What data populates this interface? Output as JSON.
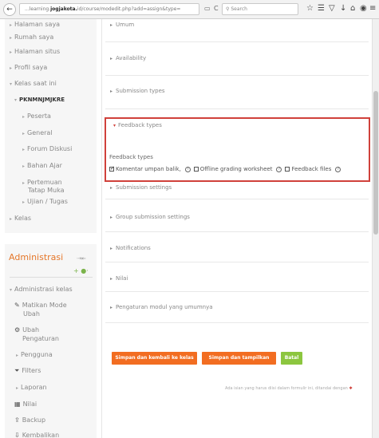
{
  "browser": {
    "url_prefix": "...learning.",
    "url_host": "jogjakota.",
    "url_path": "id/course/modedit.php?add=assign&type=",
    "reader_icon": "reader-icon",
    "refresh_icon": "refresh-icon",
    "search_placeholder": "Search"
  },
  "nav": {
    "items": [
      {
        "label": "Halaman saya",
        "caret": "▸"
      },
      {
        "label": "Rumah saya",
        "caret": "▸"
      },
      {
        "label": "Halaman situs",
        "caret": "▸"
      },
      {
        "label": "Profil saya",
        "caret": "▸"
      },
      {
        "label": "Kelas saat ini",
        "caret": "▾"
      },
      {
        "label": "PKNMNJMJKRE",
        "caret": "▾"
      },
      {
        "label": "Peserta",
        "caret": "▸"
      },
      {
        "label": "General",
        "caret": "▸"
      },
      {
        "label": "Forum Diskusi",
        "caret": "▸"
      },
      {
        "label": "Bahan Ajar",
        "caret": "▸"
      },
      {
        "label": "Pertemuan",
        "caret": "▸"
      },
      {
        "label": "Tatap Muka",
        "caret": ""
      },
      {
        "label": "Ujian / Tugas",
        "caret": "▸"
      },
      {
        "label": "Kelas",
        "caret": "▸"
      }
    ]
  },
  "admin": {
    "title": "Administrasi",
    "items": [
      {
        "label": "Administrasi kelas",
        "caret": "▾"
      },
      {
        "label": "Matikan Mode",
        "caret": "✎"
      },
      {
        "label": "Ubah",
        "caret": ""
      },
      {
        "label": "Ubah",
        "caret": "⚙"
      },
      {
        "label": "Pengaturan",
        "caret": ""
      },
      {
        "label": "Pengguna",
        "caret": "▸"
      },
      {
        "label": "Filters",
        "caret": "⏷"
      },
      {
        "label": "Laporan",
        "caret": "▸"
      },
      {
        "label": "Nilai",
        "caret": "▦"
      },
      {
        "label": "Backup",
        "caret": "⇪"
      },
      {
        "label": "Kembalikan",
        "caret": "⇩"
      }
    ]
  },
  "main": {
    "sections": [
      "Umum",
      "Availability",
      "Submission types",
      "Submission settings",
      "Group submission settings",
      "Notifications",
      "Nilai",
      "Pengaturan modul yang umumnya"
    ],
    "feedback": {
      "header": "Feedback types",
      "label": "Feedback types",
      "options": [
        {
          "label": "Komentar umpan balik",
          "checked": true
        },
        {
          "label": "Offline grading worksheet",
          "checked": false
        },
        {
          "label": "Feedback files",
          "checked": false
        }
      ]
    },
    "buttons": {
      "save_return": "Simpan dan kembali ke kelas",
      "save_display": "Simpan dan tampilkan",
      "cancel": "Batal"
    },
    "required_note": "Ada isian yang harus diisi dalam formulir ini, ditandai dengan"
  },
  "colors": {
    "accent_orange": "#f26d21",
    "cancel_green": "#8cc63f",
    "highlight_red": "#d0413b",
    "admin_title": "#e5772a"
  }
}
